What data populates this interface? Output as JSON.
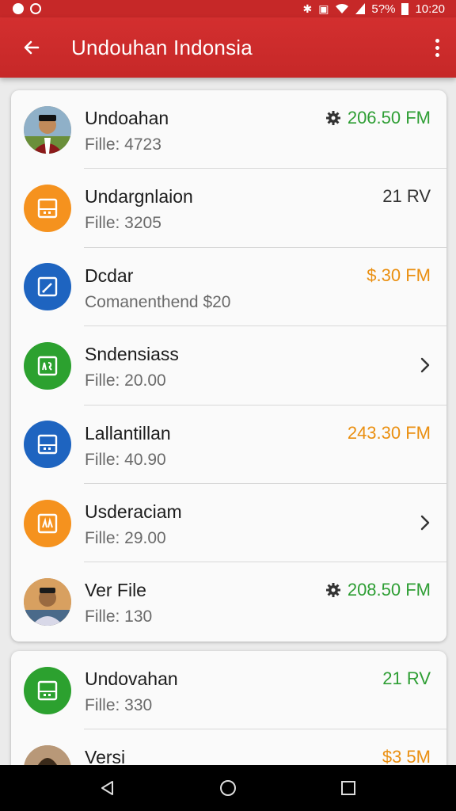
{
  "status_bar": {
    "battery": "5?%",
    "time": "10:20"
  },
  "app_bar": {
    "title": "Undouhan Indonsia"
  },
  "colors": {
    "primary": "#c62828",
    "amount_green": "#2e9e34",
    "amount_orange": "#ea8f10"
  },
  "list": [
    {
      "title": "Undoahan",
      "subtitle": "Fille: 4723",
      "amount": "206.50 FM",
      "amount_color": "green",
      "icon": "person-photo",
      "has_gear": true
    },
    {
      "title": "Undargnlaion",
      "subtitle": "Fille: 3205",
      "amount": "21 RV",
      "amount_color": "gray",
      "icon": "file-icon-orange"
    },
    {
      "title": "Dcdar",
      "subtitle": "Comanenthend  $20",
      "amount": "$.30 FM",
      "amount_color": "orange",
      "icon": "edit-icon-blue"
    },
    {
      "title": "Sndensiass",
      "subtitle": "Fille: 20.00",
      "amount": "",
      "chevron": true,
      "icon": "doc-icon-green"
    },
    {
      "title": "Lallantillan",
      "subtitle": "Fille: 40.90",
      "amount": "243.30 FM",
      "amount_color": "orange",
      "icon": "file-icon-blue"
    },
    {
      "title": "Usderaciam",
      "subtitle": "Fille: 29.00",
      "amount": "",
      "chevron": true,
      "icon": "chart-icon-orange"
    },
    {
      "title": "Ver File",
      "subtitle": "Fille: 130",
      "amount": "208.50 FM",
      "amount_color": "green",
      "icon": "person-photo",
      "has_gear": true
    }
  ],
  "list2": [
    {
      "title": "Undovahan",
      "subtitle": "Fille: 330",
      "amount": "21 RV",
      "amount_color": "green",
      "icon": "file-icon-green"
    },
    {
      "title": "Versi",
      "subtitle": "",
      "amount": "$3 5M",
      "amount_color": "orange",
      "icon": "person-photo"
    }
  ]
}
